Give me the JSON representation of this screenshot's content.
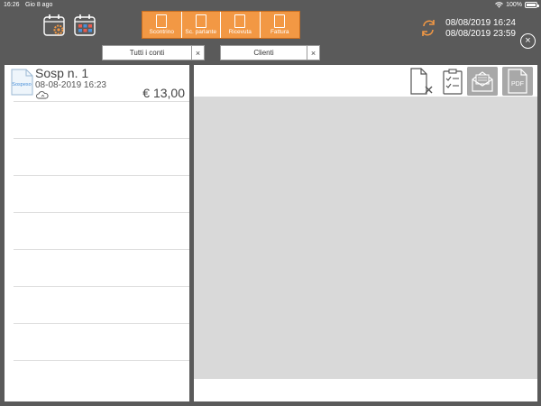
{
  "status_bar": {
    "time": "16:26",
    "date": "Gio 8 ago",
    "battery": "100%"
  },
  "doc_tabs": [
    {
      "label": "Scontrino",
      "icon": "receipt-icon"
    },
    {
      "label": "Sc. parlante",
      "icon": "person-receipt-icon"
    },
    {
      "label": "Ricevuta",
      "icon": "ricevuta-icon"
    },
    {
      "label": "Fattura",
      "icon": "invoice-pen-icon"
    }
  ],
  "date_range": {
    "from": "08/08/2019 16:24",
    "to": "08/08/2019 23:59"
  },
  "filters": {
    "accounts": "Tutti i conti",
    "clients": "Clienti",
    "clear": "×"
  },
  "list": {
    "items": [
      {
        "thumb_label": "Sospeso",
        "title": "Sosp  n.  1",
        "datetime": "08-08-2019  16:23",
        "amount": "€ 13,00"
      }
    ]
  },
  "actions": {
    "pdf_label": "PDF"
  },
  "colors": {
    "accent": "#f29844",
    "background": "#5a5a5a",
    "panel": "#ffffff",
    "grey_area": "#d9d9d9"
  }
}
